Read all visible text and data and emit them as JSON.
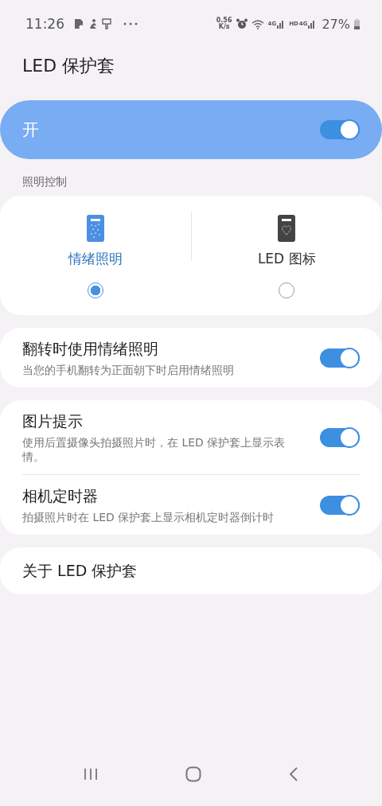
{
  "status_bar": {
    "time": "11:26",
    "speed": [
      "0.56",
      "K/s"
    ],
    "network": [
      "4G",
      "HD",
      "4G"
    ],
    "battery": "27%"
  },
  "title": "LED 保护套",
  "master_switch": {
    "label": "开",
    "on": true
  },
  "section_label": "照明控制",
  "modes": [
    {
      "label": "情绪照明",
      "selected": true
    },
    {
      "label": "LED 图标",
      "selected": false
    }
  ],
  "groups": [
    [
      {
        "kind": "toggle",
        "title": "翻转时使用情绪照明",
        "description": "当您的手机翻转为正面朝下时启用情绪照明",
        "on": true
      }
    ],
    [
      {
        "kind": "toggle",
        "title": "图片提示",
        "description": "使用后置摄像头拍摄照片时，在 LED 保护套上显示表情。",
        "on": true
      },
      {
        "kind": "toggle",
        "title": "相机定时器",
        "description": "拍摄照片时在 LED 保护套上显示相机定时器倒计时",
        "on": true
      }
    ],
    [
      {
        "kind": "link",
        "title": "关于 LED 保护套"
      }
    ]
  ]
}
